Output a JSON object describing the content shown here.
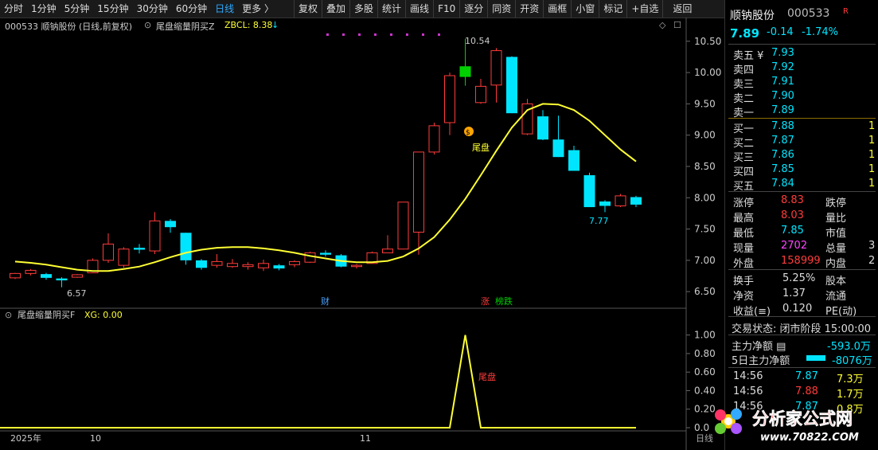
{
  "toolbar": {
    "items": [
      "分时",
      "1分钟",
      "5分钟",
      "15分钟",
      "30分钟",
      "60分钟",
      "日线",
      "更多 〉"
    ],
    "right_items": [
      "复权",
      "叠加",
      "多股",
      "统计",
      "画线",
      "F10",
      "逐分",
      "同资",
      "开资",
      "画框",
      "小窗",
      "标记",
      "+自选",
      "返回"
    ]
  },
  "chart_header": {
    "title": "000533 顺钠股份 (日线,前复权)",
    "indicator": "尾盘缩量阴买Z",
    "param": "ZBCL: 8.38"
  },
  "sub_header": {
    "indicator": "尾盘缩量阴买F",
    "param": "XG: 0.00"
  },
  "annotations": {
    "high": "10.54",
    "low_left": "6.57",
    "low_right": "7.77",
    "signal_main": "尾盘",
    "signal_sub": "尾盘",
    "tag_cai": "财",
    "tag_zhang": "涨",
    "tag_bang": "榜跌"
  },
  "x_axis": {
    "labels": [
      "2025年",
      "10",
      "11"
    ],
    "corner": "日线"
  },
  "chart_data": {
    "type": "candlestick",
    "ylim": [
      6.4,
      10.65
    ],
    "y_ticks": [
      "10.50",
      "10.00",
      "9.50",
      "9.00",
      "8.50",
      "8.00",
      "7.50",
      "7.00",
      "6.50"
    ],
    "sub_ylim": [
      0,
      1.1
    ],
    "sub_ticks": [
      "1.00",
      "0.80",
      "0.60",
      "0.40",
      "0.20",
      "0.0"
    ],
    "candles": [
      [
        6.72,
        6.79,
        6.8,
        6.7
      ],
      [
        6.79,
        6.84,
        6.86,
        6.76
      ],
      [
        6.78,
        6.72,
        6.8,
        6.69
      ],
      [
        6.71,
        6.68,
        6.73,
        6.57
      ],
      [
        6.73,
        6.77,
        6.78,
        6.72
      ],
      [
        6.8,
        7.0,
        7.03,
        6.8
      ],
      [
        7.0,
        7.26,
        7.43,
        6.96
      ],
      [
        6.92,
        7.18,
        7.21,
        6.88
      ],
      [
        7.2,
        7.17,
        7.26,
        7.11
      ],
      [
        7.15,
        7.63,
        7.77,
        7.1
      ],
      [
        7.63,
        7.53,
        7.66,
        7.44
      ],
      [
        7.44,
        7.0,
        7.44,
        6.93
      ],
      [
        7.0,
        6.88,
        7.02,
        6.85
      ],
      [
        6.92,
        6.98,
        7.1,
        6.88
      ],
      [
        6.9,
        6.95,
        7.02,
        6.88
      ],
      [
        6.9,
        6.93,
        6.97,
        6.85
      ],
      [
        6.88,
        6.95,
        7.01,
        6.83
      ],
      [
        6.92,
        6.87,
        6.94,
        6.84
      ],
      [
        6.93,
        6.98,
        7.0,
        6.89
      ],
      [
        6.97,
        7.12,
        7.14,
        6.96
      ],
      [
        7.12,
        7.09,
        7.16,
        7.06
      ],
      [
        7.08,
        6.9,
        7.1,
        6.89
      ],
      [
        6.9,
        6.92,
        6.94,
        6.87
      ],
      [
        6.95,
        7.12,
        7.14,
        6.95
      ],
      [
        7.12,
        7.18,
        7.4,
        7.12
      ],
      [
        7.18,
        7.93,
        7.93,
        7.18
      ],
      [
        7.45,
        8.73,
        8.73,
        7.09
      ],
      [
        8.73,
        9.15,
        9.2,
        8.69
      ],
      [
        9.2,
        9.95,
        10.0,
        9.0
      ],
      [
        10.1,
        9.93,
        10.54,
        9.79
      ],
      [
        9.52,
        9.78,
        9.9,
        9.5
      ],
      [
        9.8,
        10.35,
        10.39,
        9.52
      ],
      [
        10.25,
        9.35,
        10.26,
        9.35
      ],
      [
        9.02,
        9.5,
        9.58,
        9.0
      ],
      [
        9.3,
        8.93,
        9.4,
        8.92
      ],
      [
        8.93,
        8.65,
        9.31,
        8.65
      ],
      [
        8.76,
        8.43,
        8.83,
        8.43
      ],
      [
        8.36,
        7.85,
        8.4,
        7.85
      ],
      [
        7.94,
        7.87,
        7.96,
        7.77
      ],
      [
        7.87,
        8.03,
        8.06,
        7.85
      ],
      [
        8.01,
        7.89,
        8.03,
        7.85
      ]
    ],
    "ma_line": [
      6.98,
      6.96,
      6.93,
      6.89,
      6.85,
      6.83,
      6.83,
      6.86,
      6.9,
      6.97,
      7.05,
      7.12,
      7.17,
      7.2,
      7.21,
      7.21,
      7.19,
      7.16,
      7.12,
      7.07,
      7.03,
      6.99,
      6.97,
      6.97,
      6.99,
      7.06,
      7.19,
      7.37,
      7.65,
      7.98,
      8.36,
      8.75,
      9.12,
      9.4,
      9.5,
      9.49,
      9.4,
      9.23,
      9.0,
      8.77,
      8.58
    ],
    "signal_index": 29,
    "colors": {
      "up": "#ff3b3b",
      "down": "#00e5ff",
      "ma": "#ffff33",
      "signal": "#00d000"
    }
  },
  "quote": {
    "name": "顺钠股份",
    "code": "000533",
    "price": "7.89",
    "change": "-0.14",
    "change_pct": "-1.74%",
    "asks": [
      {
        "label": "卖五 ¥",
        "price": "7.93",
        "vol": "1"
      },
      {
        "label": "卖四",
        "price": "7.92",
        "vol": "1"
      },
      {
        "label": "卖三",
        "price": "7.91",
        "vol": "1"
      },
      {
        "label": "卖二",
        "price": "7.90",
        "vol": "1"
      },
      {
        "label": "卖一",
        "price": "7.89",
        "vol": "1"
      }
    ],
    "bids": [
      {
        "label": "买一",
        "price": "7.88",
        "vol": "1"
      },
      {
        "label": "买二",
        "price": "7.87",
        "vol": "1"
      },
      {
        "label": "买三",
        "price": "7.86",
        "vol": "1"
      },
      {
        "label": "买四",
        "price": "7.85",
        "vol": "1"
      },
      {
        "label": "买五",
        "price": "7.84",
        "vol": "1"
      }
    ],
    "stats": [
      {
        "l1": "涨停",
        "v1": "8.83",
        "c1": "#ff3b3b",
        "l2": "跌停"
      },
      {
        "l1": "最高",
        "v1": "8.03",
        "c1": "#ff3b3b",
        "l2": "量比"
      },
      {
        "l1": "最低",
        "v1": "7.85",
        "c1": "#00e5ff",
        "l2": "市值"
      },
      {
        "l1": "现量",
        "v1": "2702",
        "c1": "#ff44ff",
        "l2": "总量",
        "v2": "3"
      },
      {
        "l1": "外盘",
        "v1": "158999",
        "c1": "#ff3b3b",
        "l2": "内盘",
        "v2": "2"
      }
    ],
    "stats2": [
      {
        "l1": "换手",
        "v1": "5.25%",
        "l2": "股本"
      },
      {
        "l1": "净资",
        "v1": "1.37",
        "l2": "流通"
      },
      {
        "l1": "收益(≡)",
        "v1": "0.120",
        "l2": "PE(动)"
      }
    ],
    "status": "交易状态: 闭市阶段 15:00:00",
    "flow": [
      {
        "label": "主力净额 ▤",
        "value": "-593.0万"
      },
      {
        "label": "5日主力净额",
        "value": "-8076万"
      }
    ],
    "ticks": [
      {
        "time": "14:56",
        "price": "7.87",
        "vol": "7.3万"
      },
      {
        "time": "14:56",
        "price": "7.88",
        "vol": "1.7万"
      },
      {
        "time": "14:56",
        "price": "7.87",
        "vol": "0.8万"
      }
    ]
  },
  "watermark": {
    "text": "分析家公式网",
    "url": "www.70822.COM"
  }
}
